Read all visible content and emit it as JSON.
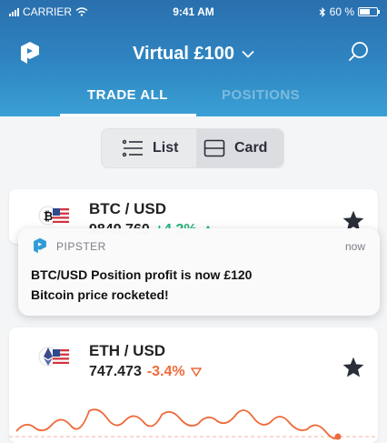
{
  "status_bar": {
    "carrier": "CARRIER",
    "time": "9:41 AM",
    "battery": "60 %",
    "battery_level": 0.6
  },
  "header": {
    "account_name": "Virtual £100"
  },
  "tabs": [
    {
      "label": "TRADE ALL",
      "active": true
    },
    {
      "label": "POSITIONS",
      "active": false
    }
  ],
  "view_toggle": {
    "list_label": "List",
    "card_label": "Card",
    "selected": "Card"
  },
  "instruments": [
    {
      "pair": "BTC / USD",
      "price": "9849.760",
      "change": "+4.2%",
      "direction": "up",
      "starred": true
    },
    {
      "pair": "ETH / USD",
      "price": "747.473",
      "change": "-3.4%",
      "direction": "down",
      "starred": true
    }
  ],
  "notification": {
    "app": "PIPSTER",
    "time": "now",
    "title": "BTC/USD Position profit is now £120",
    "body": "Bitcoin price rocketed!"
  },
  "colors": {
    "header": "#2f86c2",
    "up": "#23b37a",
    "down": "#ef6a3a",
    "brand": "#2f9bd8"
  },
  "icons": {
    "logo": "pipster-logo-icon",
    "search": "search-icon",
    "star": "star-icon",
    "dropdown": "chevron-down-icon",
    "list": "list-icon",
    "card": "card-icon"
  }
}
